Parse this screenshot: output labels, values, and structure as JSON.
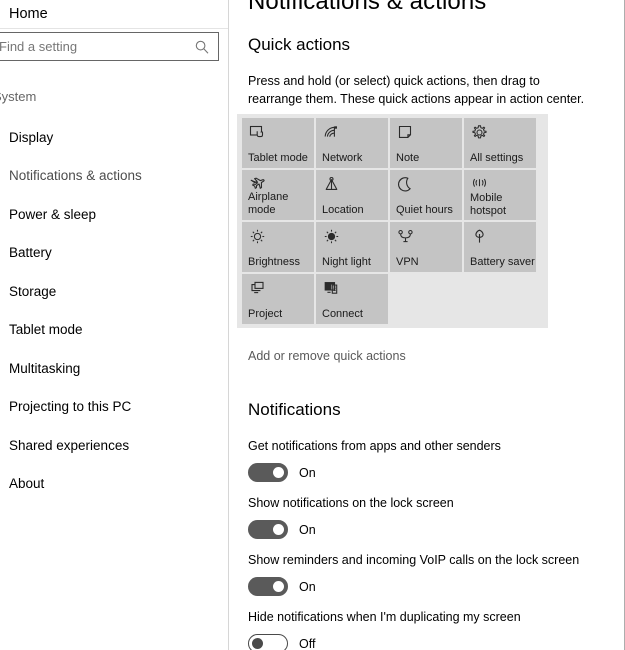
{
  "sidebar": {
    "home_label": "Home",
    "search": {
      "placeholder": "Find a setting",
      "value": "",
      "icon": "search-icon"
    },
    "group_label": "System",
    "items": [
      {
        "label": "Display",
        "selected": false
      },
      {
        "label": "Notifications & actions",
        "selected": true
      },
      {
        "label": "Power & sleep",
        "selected": false
      },
      {
        "label": "Battery",
        "selected": false
      },
      {
        "label": "Storage",
        "selected": false
      },
      {
        "label": "Tablet mode",
        "selected": false
      },
      {
        "label": "Multitasking",
        "selected": false
      },
      {
        "label": "Projecting to this PC",
        "selected": false
      },
      {
        "label": "Shared experiences",
        "selected": false
      },
      {
        "label": "About",
        "selected": false
      }
    ]
  },
  "content": {
    "page_title": "Notifications & actions",
    "quick_actions": {
      "title": "Quick actions",
      "description": "Press and hold (or select) quick actions, then drag to rearrange them. These quick actions appear in action center.",
      "link_label": "Add or remove quick actions",
      "tiles": [
        [
          {
            "label": "Tablet mode",
            "icon": "tablet-mode-icon"
          },
          {
            "label": "Network",
            "icon": "network-icon"
          },
          {
            "label": "Note",
            "icon": "note-icon"
          },
          {
            "label": "All settings",
            "icon": "gear-icon"
          }
        ],
        [
          {
            "label": "Airplane mode",
            "icon": "airplane-icon"
          },
          {
            "label": "Location",
            "icon": "location-icon"
          },
          {
            "label": "Quiet hours",
            "icon": "moon-icon"
          },
          {
            "label": "Mobile\nhotspot",
            "icon": "hotspot-icon"
          }
        ],
        [
          {
            "label": "Brightness",
            "icon": "brightness-icon"
          },
          {
            "label": "Night light",
            "icon": "night-light-icon"
          },
          {
            "label": "VPN",
            "icon": "vpn-icon"
          },
          {
            "label": "Battery saver",
            "icon": "battery-saver-icon"
          }
        ],
        [
          {
            "label": "Project",
            "icon": "project-icon"
          },
          {
            "label": "Connect",
            "icon": "connect-icon"
          }
        ]
      ]
    },
    "notifications": {
      "title": "Notifications",
      "settings": [
        {
          "label": "Get notifications from apps and other senders",
          "state": "On",
          "on": true
        },
        {
          "label": "Show notifications on the lock screen",
          "state": "On",
          "on": true
        },
        {
          "label": "Show reminders and incoming VoIP calls on the lock screen",
          "state": "On",
          "on": true
        },
        {
          "label": "Hide notifications when I'm duplicating my screen",
          "state": "Off",
          "on": false
        }
      ]
    }
  },
  "colors": {
    "tile_bg": "#c4c4c4",
    "tile_grid_bg": "#e6e6e6",
    "toggle_on": "#5a5a5a",
    "link": "#5a5a5a",
    "selected_nav": "#4c4c4c"
  }
}
